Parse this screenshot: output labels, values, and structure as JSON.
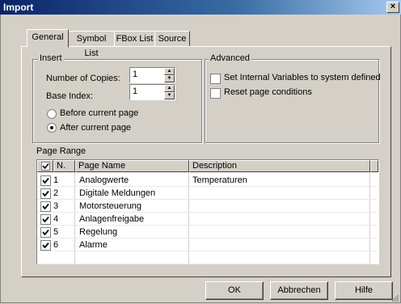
{
  "window": {
    "title": "Import",
    "close_glyph": "×"
  },
  "tabs": [
    {
      "label": "General"
    },
    {
      "label": "Symbol List"
    },
    {
      "label": "FBox List"
    },
    {
      "label": "Source"
    }
  ],
  "insert": {
    "legend": "Insert",
    "copies_label": "Number of Copies:",
    "copies_value": "1",
    "base_label": "Base Index:",
    "base_value": "1",
    "before_label": "Before current page",
    "after_label": "After current page",
    "selected": "after"
  },
  "advanced": {
    "legend": "Advanced",
    "set_vars_label": "Set Internal Variables to system defined",
    "reset_label": "Reset page conditions",
    "set_vars_checked": false,
    "reset_checked": false
  },
  "page_range": {
    "label": "Page Range",
    "columns": [
      "N.",
      "Page Name",
      "Description"
    ],
    "rows": [
      {
        "n": "1",
        "name": "Analogwerte",
        "desc": "Temperaturen",
        "checked": true
      },
      {
        "n": "2",
        "name": "Digitale Meldungen",
        "desc": "",
        "checked": true
      },
      {
        "n": "3",
        "name": "Motorsteuerung",
        "desc": "",
        "checked": true
      },
      {
        "n": "4",
        "name": "Anlagenfreigabe",
        "desc": "",
        "checked": true
      },
      {
        "n": "5",
        "name": "Regelung",
        "desc": "",
        "checked": true
      },
      {
        "n": "6",
        "name": "Alarme",
        "desc": "",
        "checked": true
      }
    ]
  },
  "buttons": {
    "ok": "OK",
    "cancel": "Abbrechen",
    "help": "Hilfe"
  }
}
